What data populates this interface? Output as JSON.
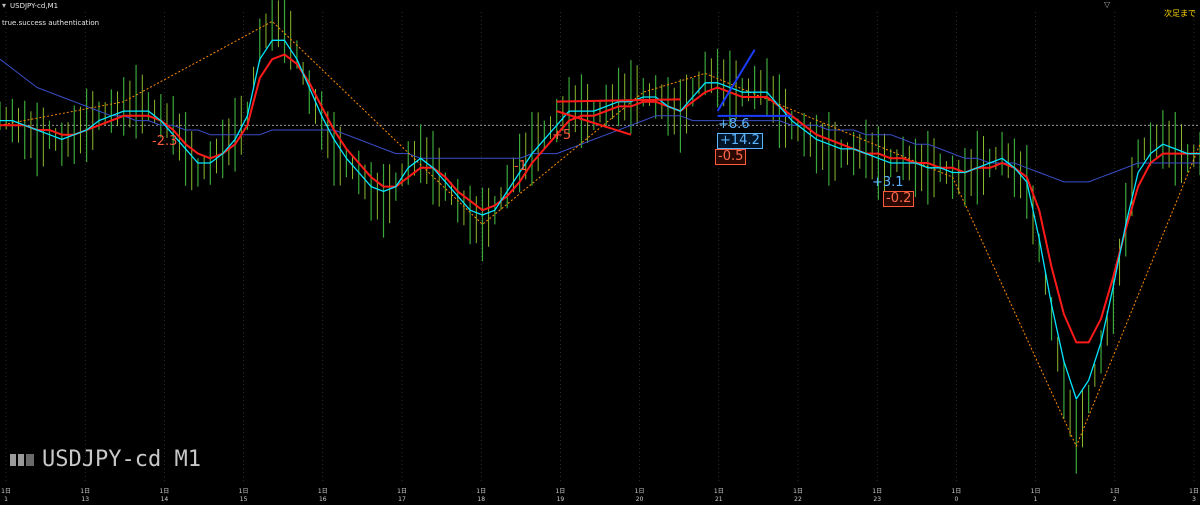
{
  "window": {
    "title": "USDJPY-cd,M1",
    "auth_text": "true.success authentication",
    "right_label": "次足まで",
    "watermark": "USDJPY-cd M1"
  },
  "colors": {
    "background": "#000000",
    "price_bars": "#3aa83a",
    "fast_ma": "#00e5ff",
    "slow_ma": "#ff1a1a",
    "long_ma": "#3a4fc8",
    "zigzag": "#ff8c00",
    "grid": "#4a4a4a",
    "price_line": "#cccccc"
  },
  "chart_data": {
    "type": "line",
    "symbol": "USDJPY-cd",
    "timeframe": "M1",
    "x_ticks": [
      "1日",
      "1日",
      "1日",
      "1日",
      "1日",
      "1日",
      "1日",
      "1日",
      "1日",
      "1日",
      "1日",
      "1日",
      "1日",
      "1日",
      "1日",
      "1日"
    ],
    "x_tick_nums": [
      "1",
      "13",
      "14",
      "15",
      "16",
      "17",
      "18",
      "19",
      "20",
      "21",
      "22",
      "23",
      "0",
      "1",
      "2",
      "3"
    ],
    "ylim": [
      0,
      100
    ],
    "current_price_level": 76,
    "grid": true,
    "series": [
      {
        "key": "bars",
        "values": [
          78,
          77,
          75,
          73,
          74,
          72,
          74,
          76,
          78,
          79,
          80,
          81,
          80,
          78,
          76,
          71,
          66,
          68,
          71,
          74,
          78,
          94,
          98,
          97,
          91,
          83,
          77,
          71,
          68,
          66,
          62,
          60,
          63,
          68,
          70,
          67,
          63,
          60,
          57,
          55,
          58,
          63,
          68,
          71,
          74,
          77,
          80,
          79,
          78,
          80,
          82,
          82,
          83,
          82,
          80,
          78,
          83,
          87,
          86,
          84,
          83,
          84,
          84,
          79,
          76,
          74,
          72,
          71,
          70,
          70,
          71,
          68,
          68,
          69,
          67,
          67,
          67,
          65,
          65,
          67,
          68,
          70,
          67,
          64,
          50,
          35,
          20,
          10,
          18,
          28,
          38,
          56,
          70,
          72,
          73,
          71,
          69,
          70
        ]
      },
      {
        "key": "fast_ma",
        "values": [
          77,
          77,
          76,
          75,
          74,
          73,
          74,
          75,
          77,
          78,
          79,
          79,
          79,
          77,
          74,
          71,
          68,
          68,
          70,
          73,
          78,
          90,
          94,
          94,
          90,
          84,
          78,
          73,
          69,
          66,
          63,
          62,
          63,
          67,
          69,
          67,
          64,
          61,
          58,
          57,
          58,
          62,
          66,
          70,
          73,
          76,
          79,
          79,
          79,
          80,
          81,
          81,
          82,
          82,
          80,
          79,
          82,
          85,
          85,
          84,
          83,
          83,
          83,
          80,
          77,
          75,
          73,
          72,
          71,
          71,
          70,
          69,
          68,
          68,
          68,
          67,
          67,
          66,
          66,
          67,
          68,
          69,
          67,
          64,
          52,
          38,
          26,
          18,
          22,
          30,
          42,
          55,
          66,
          70,
          72,
          71,
          70,
          70
        ]
      },
      {
        "key": "slow_ma",
        "values": [
          76,
          76,
          76,
          75,
          75,
          74,
          74,
          75,
          76,
          77,
          78,
          78,
          78,
          77,
          75,
          72,
          70,
          69,
          70,
          72,
          76,
          86,
          90,
          91,
          89,
          85,
          80,
          75,
          71,
          68,
          65,
          63,
          63,
          65,
          67,
          67,
          65,
          62,
          60,
          58,
          59,
          61,
          64,
          68,
          71,
          74,
          77,
          78,
          78,
          79,
          80,
          80,
          81,
          81,
          80,
          79,
          81,
          83,
          84,
          83,
          82,
          82,
          82,
          80,
          78,
          76,
          74,
          73,
          72,
          71,
          70,
          70,
          69,
          69,
          68,
          68,
          67,
          67,
          66,
          67,
          67,
          68,
          67,
          65,
          58,
          46,
          36,
          30,
          30,
          35,
          44,
          54,
          63,
          68,
          70,
          70,
          70,
          70
        ]
      },
      {
        "key": "long_ma",
        "values": [
          90,
          88,
          86,
          84,
          83,
          82,
          81,
          80,
          79,
          78,
          78,
          77,
          77,
          76,
          76,
          75,
          75,
          74,
          74,
          74,
          74,
          74,
          75,
          75,
          75,
          75,
          75,
          75,
          74,
          73,
          72,
          71,
          70,
          70,
          69,
          69,
          69,
          69,
          69,
          69,
          69,
          69,
          69,
          70,
          70,
          70,
          71,
          72,
          73,
          74,
          75,
          76,
          77,
          78,
          78,
          78,
          77,
          77,
          77,
          77,
          77,
          77,
          77,
          77,
          76,
          76,
          76,
          75,
          75,
          75,
          74,
          74,
          74,
          73,
          72,
          72,
          71,
          70,
          69,
          69,
          68,
          68,
          68,
          67,
          66,
          65,
          64,
          64,
          64,
          65,
          66,
          67,
          68,
          68,
          68,
          68,
          68,
          68
        ]
      },
      {
        "key": "zigzag",
        "values": [
          76,
          null,
          null,
          null,
          null,
          null,
          null,
          null,
          null,
          null,
          81,
          null,
          null,
          null,
          null,
          null,
          null,
          null,
          null,
          null,
          null,
          null,
          98,
          null,
          null,
          null,
          null,
          null,
          null,
          null,
          null,
          null,
          null,
          null,
          null,
          null,
          null,
          null,
          null,
          55,
          null,
          null,
          null,
          null,
          null,
          null,
          null,
          null,
          null,
          null,
          null,
          null,
          83,
          null,
          null,
          null,
          null,
          87,
          null,
          null,
          null,
          null,
          null,
          null,
          null,
          null,
          null,
          null,
          null,
          null,
          null,
          null,
          null,
          null,
          null,
          null,
          null,
          65,
          null,
          null,
          null,
          null,
          null,
          null,
          null,
          null,
          null,
          8,
          null,
          null,
          null,
          null,
          null,
          null,
          null,
          null,
          null,
          72
        ]
      }
    ],
    "annotations": [
      {
        "text": "-2.3",
        "color": "red",
        "style": "plain"
      },
      {
        "text": "-1",
        "color": "red",
        "style": "plain"
      },
      {
        "text": "+5",
        "color": "red",
        "style": "plain"
      },
      {
        "text": "+8.6",
        "color": "blue",
        "style": "plain"
      },
      {
        "text": "+14.2",
        "color": "blue",
        "style": "box"
      },
      {
        "text": "-0.5",
        "color": "red",
        "style": "box"
      },
      {
        "text": "+3.1",
        "color": "blue",
        "style": "plain"
      },
      {
        "text": "-0.2",
        "color": "red",
        "style": "box"
      }
    ]
  }
}
